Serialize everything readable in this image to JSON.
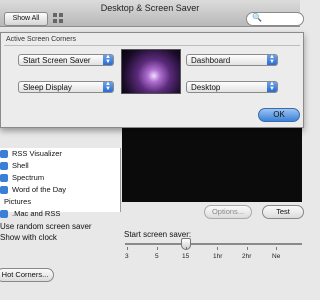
{
  "window": {
    "title": "Desktop & Screen Saver",
    "show_all_label": "Show All",
    "search_placeholder": ""
  },
  "sheet": {
    "title": "Active Screen Corners",
    "top_left": "Start Screen Saver",
    "top_right": "Dashboard",
    "bottom_left": "Sleep Display",
    "bottom_right": "Desktop",
    "ok_label": "OK"
  },
  "list": [
    {
      "label": "RSS Visualizer"
    },
    {
      "label": "Shell"
    },
    {
      "label": "Spectrum"
    },
    {
      "label": "Word of the Day"
    },
    {
      "label": "Pictures"
    },
    {
      "label": ".Mac and RSS"
    }
  ],
  "options_label": "Options...",
  "test_label": "Test",
  "use_random_label": "Use random screen saver",
  "show_clock_label": "Show with clock",
  "start_label": "Start screen saver:",
  "slider_ticks": [
    "3",
    "5",
    "15",
    "1hr",
    "2hr",
    "Ne"
  ],
  "slider_value": "15",
  "hot_corners_label": "Hot Corners...",
  "colors": {
    "accent": "#3b82d8",
    "preview": "#0b0b0b"
  }
}
